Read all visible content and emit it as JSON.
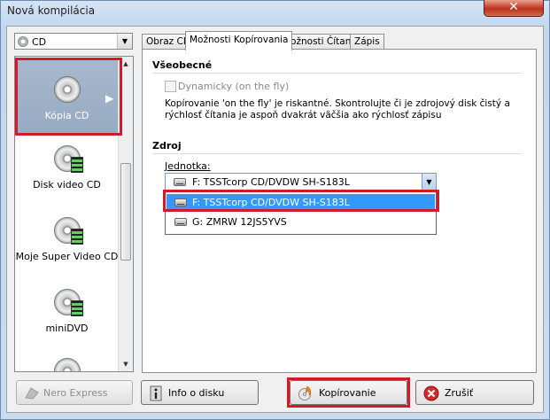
{
  "window": {
    "title": "Nová kompilácia",
    "close_glyph": "✕"
  },
  "left_combo": {
    "selected": "CD",
    "icon": "cd-icon"
  },
  "compilation_list": [
    {
      "label": "Kópia CD",
      "icon": "disc-copy-icon",
      "selected": true
    },
    {
      "label": "Disk video CD",
      "icon": "video-disc-icon"
    },
    {
      "label": "Moje Super Video CD",
      "icon": "video-disc-icon"
    },
    {
      "label": "miniDVD",
      "icon": "video-disc-icon"
    }
  ],
  "tabs": [
    {
      "label": "Obraz CD"
    },
    {
      "label": "Možnosti Kopírovania",
      "active": true
    },
    {
      "label": "Možnosti Čítania"
    },
    {
      "label": "Zápis"
    }
  ],
  "general": {
    "title": "Všeobecné",
    "checkbox_label": "Dynamicky (on the fly)",
    "checkbox_checked": false,
    "checkbox_enabled": false,
    "warning": "Kopírovanie 'on the fly' je riskantné. Skontrolujte či je zdrojový disk čistý a rýchlosť čítania je aspoň dvakrát väčšia ako rýchlosť zápisu"
  },
  "source": {
    "title": "Zdroj",
    "drive_label": "Jednotka:",
    "selected_drive": "F: TSSTcorp CD/DVDW SH-S183L",
    "options": [
      {
        "label": "F: TSSTcorp CD/DVDW SH-S183L",
        "highlighted": true
      },
      {
        "label": "G: ZMRW 12JS5YVS"
      }
    ]
  },
  "buttons": {
    "nero_express": "Nero Express",
    "disc_info": "Info o disku",
    "copy": "Kopírovanie",
    "cancel": "Zrušiť"
  },
  "colors": {
    "highlight_box": "#d11a2a",
    "selection_blue": "#3399ff",
    "selected_item_bg": "#a7b8cc"
  }
}
